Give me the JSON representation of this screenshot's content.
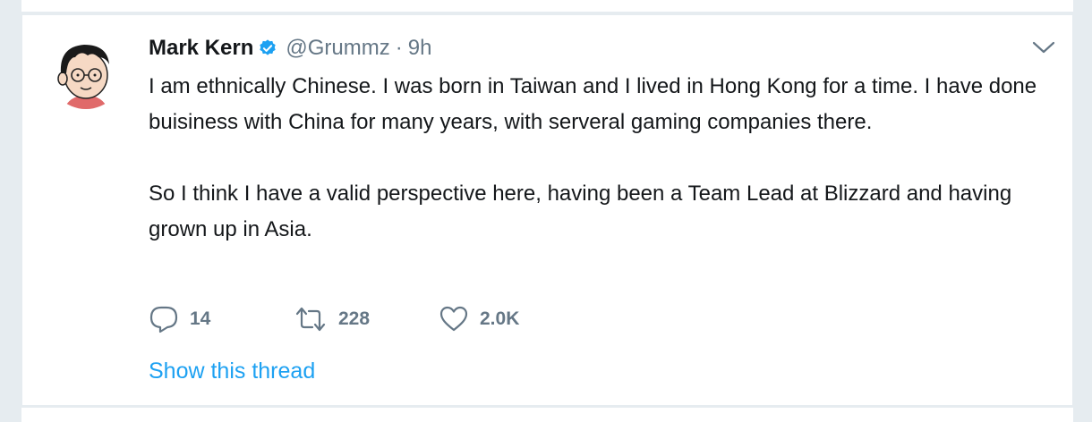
{
  "tweet": {
    "author_name": "Mark Kern",
    "handle": "@Grummz",
    "separator": "·",
    "time": "9h",
    "paragraph_1": "I am ethnically Chinese. I was born in Taiwan and I lived in Hong Kong for a time. I have done buisiness with China for many years, with serveral gaming companies there.",
    "paragraph_2": "So I think I have a valid perspective here, having been a Team Lead at Blizzard and having grown up in Asia.",
    "show_thread": "Show this thread"
  },
  "actions": {
    "reply_count": "14",
    "retweet_count": "228",
    "like_count": "2.0K"
  },
  "icons": {
    "avatar": "cartoon-man-avatar",
    "verified": "verified-badge-icon",
    "menu": "chevron-down-icon",
    "reply": "reply-bubble-icon",
    "retweet": "retweet-icon",
    "like": "heart-icon"
  },
  "colors": {
    "link_blue": "#1da1f2",
    "text_primary": "#14171a",
    "text_secondary": "#657786",
    "background": "#e6ecf0"
  }
}
